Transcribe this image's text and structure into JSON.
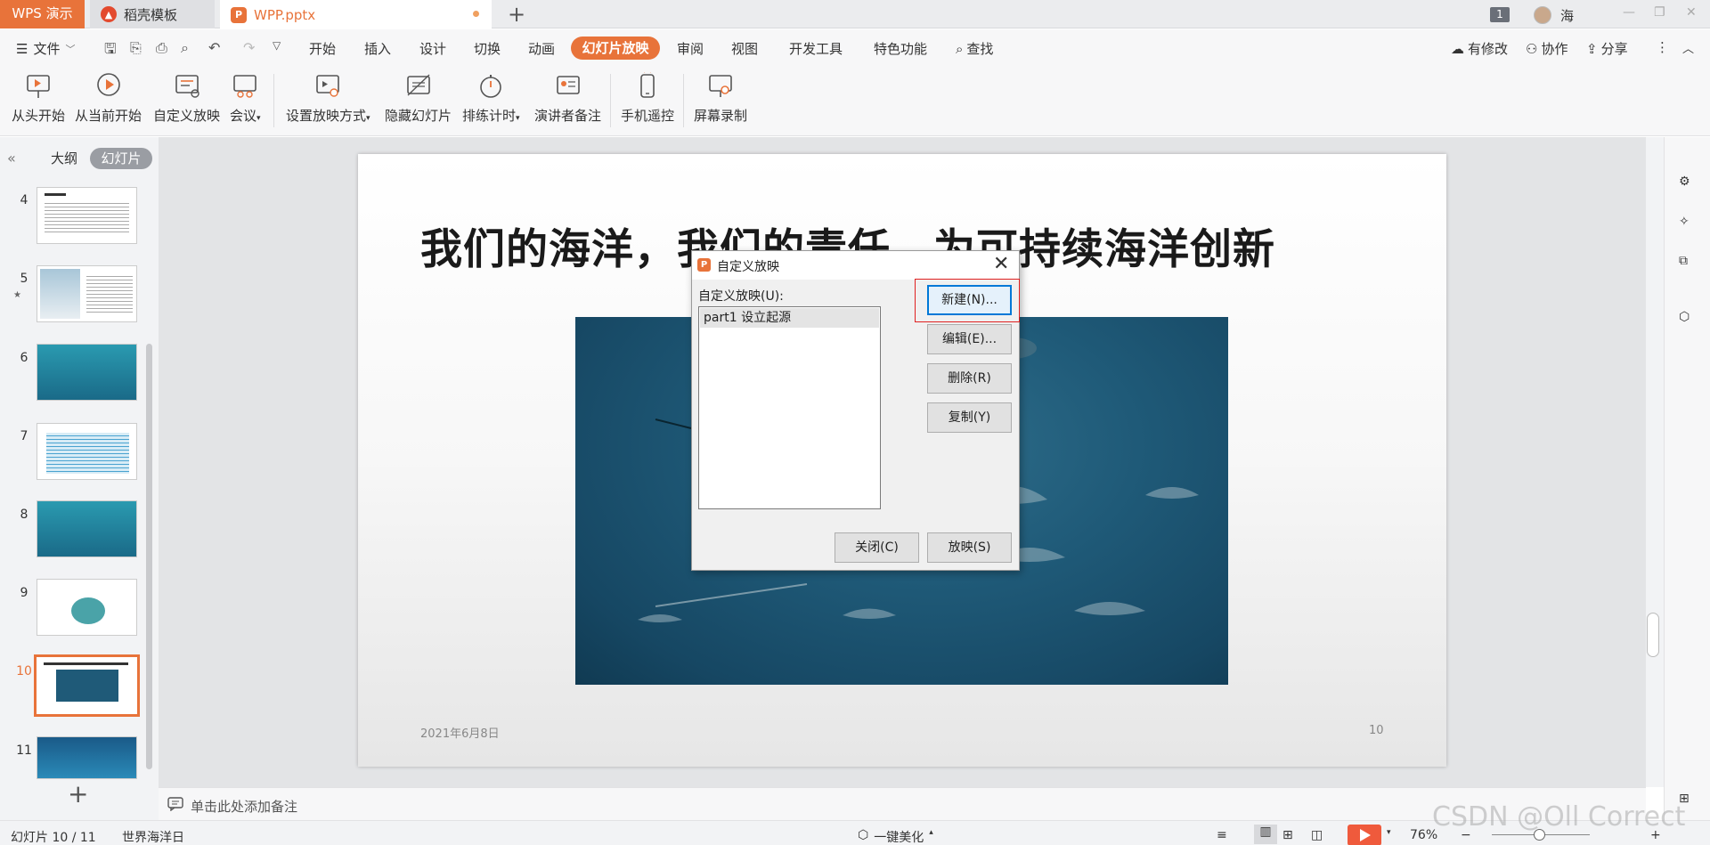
{
  "titlebar": {
    "app_name": "WPS 演示",
    "tabs": [
      {
        "label": "稻壳模板"
      },
      {
        "label": "WPP.pptx"
      }
    ],
    "page_badge": "1",
    "user_name": "海"
  },
  "menu": {
    "file_label": "文件",
    "items": [
      "开始",
      "插入",
      "设计",
      "切换",
      "动画",
      "幻灯片放映",
      "审阅",
      "视图",
      "开发工具",
      "特色功能"
    ],
    "active_item": "幻灯片放映",
    "search_label": "查找",
    "right": {
      "modified": "有修改",
      "collab": "协作",
      "share": "分享"
    }
  },
  "ribbon": {
    "buttons": [
      {
        "label": "从头开始",
        "icon": "play-from-start-icon"
      },
      {
        "label": "从当前开始",
        "icon": "play-current-icon"
      },
      {
        "label": "自定义放映",
        "icon": "custom-show-icon"
      },
      {
        "label": "会议",
        "icon": "meeting-icon"
      },
      {
        "label": "设置放映方式",
        "icon": "setup-show-icon"
      },
      {
        "label": "隐藏幻灯片",
        "icon": "hide-slide-icon"
      },
      {
        "label": "排练计时",
        "icon": "rehearse-timing-icon"
      },
      {
        "label": "演讲者备注",
        "icon": "speaker-notes-icon"
      },
      {
        "label": "手机遥控",
        "icon": "phone-remote-icon"
      },
      {
        "label": "屏幕录制",
        "icon": "screen-record-icon"
      }
    ]
  },
  "left_panel": {
    "tab_outline": "大纲",
    "tab_slides": "幻灯片",
    "slides": [
      {
        "num": "4"
      },
      {
        "num": "5"
      },
      {
        "num": "6"
      },
      {
        "num": "7"
      },
      {
        "num": "8"
      },
      {
        "num": "9"
      },
      {
        "num": "10"
      },
      {
        "num": "11"
      }
    ],
    "active_slide": "10"
  },
  "slide": {
    "title": "我们的海洋，我们的责任，为可持续海洋创新",
    "date": "2021年6月8日",
    "number": "10"
  },
  "notes": {
    "placeholder": "单击此处添加备注"
  },
  "statusbar": {
    "slide_counter": "幻灯片 10 / 11",
    "theme": "世界海洋日",
    "beautify": "一键美化",
    "zoom": "76%",
    "watermark": "CSDN @Oll Correct"
  },
  "dialog": {
    "title": "自定义放映",
    "list_label": "自定义放映(U):",
    "shows": [
      "part1 设立起源"
    ],
    "buttons": {
      "new": "新建(N)...",
      "edit": "编辑(E)...",
      "delete": "删除(R)",
      "copy": "复制(Y)",
      "close": "关闭(C)",
      "show": "放映(S)"
    }
  },
  "colors": {
    "accent": "#e8733a",
    "focus": "#0078d7",
    "highlight_box": "#e02020"
  }
}
